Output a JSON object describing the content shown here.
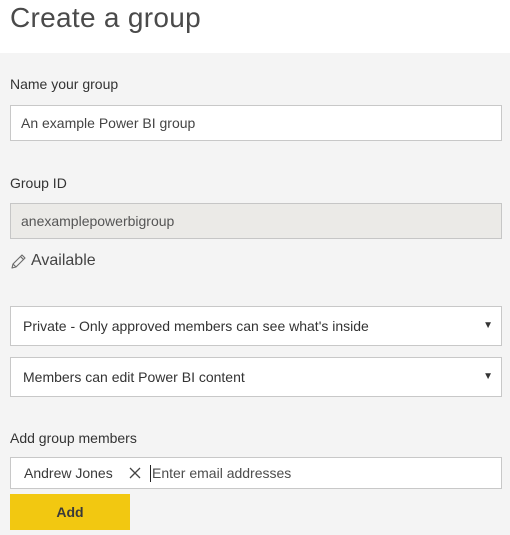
{
  "page": {
    "title": "Create a group"
  },
  "name_section": {
    "label": "Name your group",
    "value": "An example Power BI group"
  },
  "group_id_section": {
    "label": "Group ID",
    "value": "anexamplepowerbigroup",
    "status_icon": "pencil-icon",
    "status_text": "Available"
  },
  "privacy_select": {
    "selected": "Private - Only approved members can see what's inside"
  },
  "permissions_select": {
    "selected": "Members can edit Power BI content"
  },
  "members_section": {
    "label": "Add group members",
    "chips": [
      {
        "name": "Andrew Jones"
      }
    ],
    "input_placeholder": "Enter email addresses",
    "add_label": "Add"
  },
  "colors": {
    "accent_yellow": "#f2c811",
    "readonly_bg": "#ebeae7",
    "page_bg": "#f4f4f4"
  }
}
